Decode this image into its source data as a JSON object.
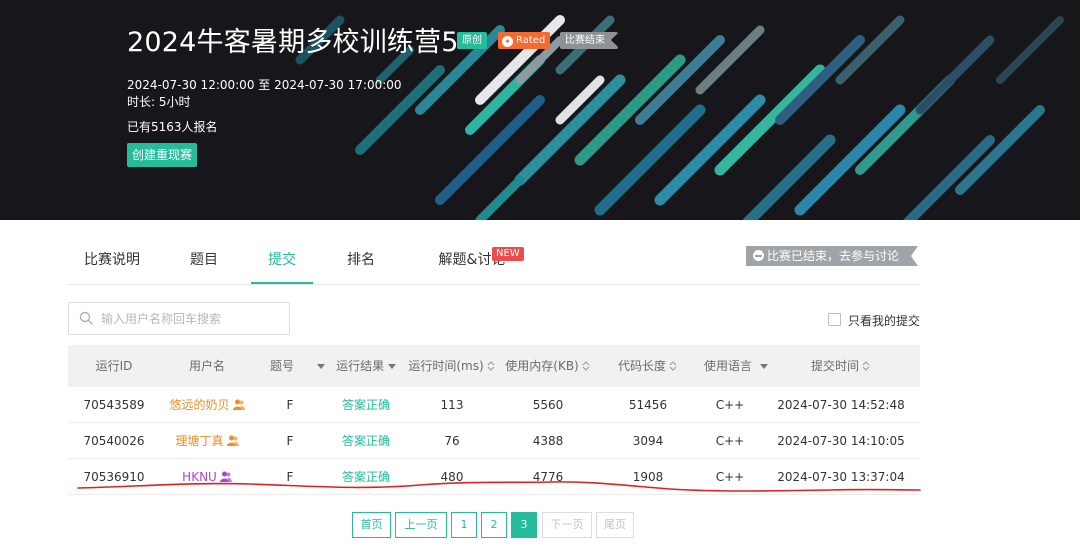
{
  "contest": {
    "title": "2024牛客暑期多校训练营5",
    "tags": {
      "original": "原创",
      "rated": "Rated",
      "ended": "比赛结束"
    },
    "time_range": "2024-07-30 12:00:00 至 2024-07-30 17:00:00",
    "duration": "时长: 5小时",
    "signup": "已有5163人报名",
    "recreate_button": "创建重现赛"
  },
  "tabs": [
    {
      "label": "比赛说明",
      "active": false
    },
    {
      "label": "题目",
      "active": false
    },
    {
      "label": "提交",
      "active": true
    },
    {
      "label": "排名",
      "active": false
    },
    {
      "label": "解题&讨论",
      "active": false
    }
  ],
  "new_badge": "NEW",
  "ended_notice": "比赛已结束，去参与讨论",
  "search": {
    "placeholder": "输入用户名称回车搜索",
    "value": ""
  },
  "only_mine_label": "只看我的提交",
  "table": {
    "headers": [
      "运行ID",
      "用户名",
      "题号",
      "运行结果",
      "运行时间(ms)",
      "使用内存(KB)",
      "代码长度",
      "使用语言",
      "提交时间"
    ],
    "rows": [
      {
        "id": "70543589",
        "user": "悠远的奶贝",
        "problem": "F",
        "result": "答案正确",
        "time": "113",
        "memory": "5560",
        "length": "51456",
        "language": "C++",
        "submitted": "2024-07-30 14:52:48"
      },
      {
        "id": "70540026",
        "user": "理塘丁真",
        "problem": "F",
        "result": "答案正确",
        "time": "76",
        "memory": "4388",
        "length": "3094",
        "language": "C++",
        "submitted": "2024-07-30 14:10:05"
      },
      {
        "id": "70536910",
        "user": "HKNU",
        "problem": "F",
        "result": "答案正确",
        "time": "480",
        "memory": "4776",
        "length": "1908",
        "language": "C++",
        "submitted": "2024-07-30 13:37:04"
      }
    ]
  },
  "pagination": {
    "first": "首页",
    "prev": "上一页",
    "pages": [
      "1",
      "2",
      "3"
    ],
    "current": "3",
    "next": "下一页",
    "last": "尾页"
  },
  "colors": {
    "accent": "#25bb9b",
    "rated": "#f56a2f",
    "user_orange": "#ee8f2b",
    "user_purple": "#a646d9",
    "annotation_red": "#e02020"
  },
  "icons": [
    "search-icon",
    "sort-icon",
    "filter-icon",
    "user-icon",
    "minus-icon",
    "rated-icon"
  ]
}
